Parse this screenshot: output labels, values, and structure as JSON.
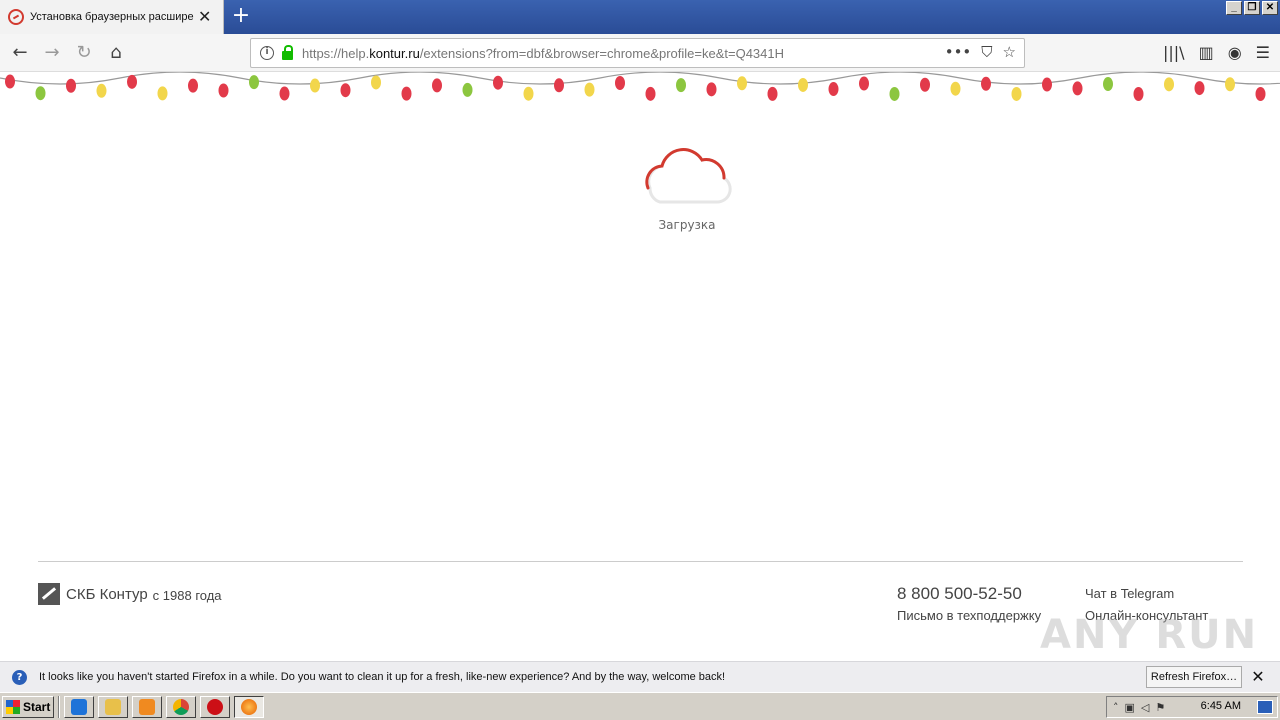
{
  "browser": {
    "tab": {
      "title": "Установка браузерных расшире",
      "close_label": "✕"
    },
    "new_tab_label": "+",
    "window_buttons": [
      "_",
      "❐",
      "✕"
    ],
    "url": {
      "prefix": "https://help.",
      "host": "kontur.ru",
      "path": "/extensions?from=dbf&browser=chrome&profile=ke&t=Q4341H"
    },
    "url_actions": [
      "•••",
      "⛉",
      "☆"
    ],
    "nav": {
      "back": "←",
      "forward": "→",
      "reload": "↻",
      "home": "⌂"
    },
    "toolbar": [
      "|||\\",
      "▥",
      "◉",
      "☰"
    ]
  },
  "page": {
    "loading_label": "Загрузка",
    "brand_name": "СКБ Контур",
    "brand_since": "с 1988 года",
    "phone": "8 800 500-52-50",
    "support_link": "Письмо в техподдержку",
    "telegram_link": "Чат в Telegram",
    "consultant_link": "Онлайн-консультант",
    "watermark": "ANY RUN",
    "colors": {
      "cloud_accent": "#d23a2f",
      "cloud_base": "#e6e6e6"
    }
  },
  "notification": {
    "text": "It looks like you haven't started Firefox in a while. Do you want to clean it up for a fresh, like-new experience? And by the way, welcome back!",
    "button": "Refresh Firefox…",
    "close": "✕"
  },
  "taskbar": {
    "start_label": "Start",
    "clock": "6:45 AM",
    "items": [
      "ie-icon",
      "folder-icon",
      "media-icon",
      "chrome-icon",
      "opera-icon",
      "firefox-icon"
    ]
  }
}
